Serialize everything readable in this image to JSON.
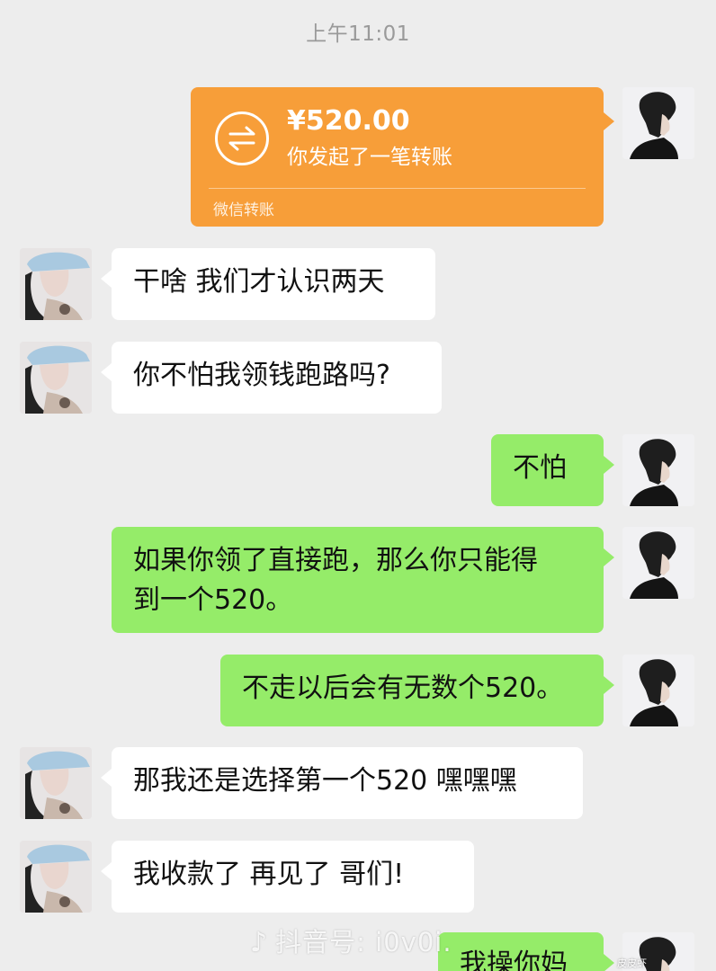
{
  "timestamp": "上午11:01",
  "transfer": {
    "amount": "¥520.00",
    "description": "你发起了一笔转账",
    "label": "微信转账",
    "card_color": "#f79e39"
  },
  "messages": [
    {
      "sender": "her",
      "text": "干啥 我们才认识两天"
    },
    {
      "sender": "her",
      "text": "你不怕我领钱跑路吗?"
    },
    {
      "sender": "me",
      "text": "不怕"
    },
    {
      "sender": "me",
      "text": "如果你领了直接跑，那么你只能得\n到一个520。"
    },
    {
      "sender": "me",
      "text": "不走以后会有无数个520。"
    },
    {
      "sender": "her",
      "text": "那我还是选择第一个520 嘿嘿嘿"
    },
    {
      "sender": "her",
      "text": "我收款了 再见了 哥们!"
    },
    {
      "sender": "me",
      "text": "我操你妈"
    }
  ],
  "watermark": {
    "icon": "tiktok-note-icon",
    "text": "抖音号: i0v0i.",
    "small": "皮皮虾"
  },
  "colors": {
    "background": "#ededed",
    "green_bubble": "#95ec69",
    "white_bubble": "#ffffff"
  }
}
